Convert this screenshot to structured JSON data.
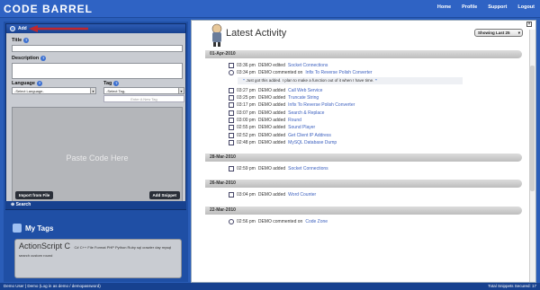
{
  "app": {
    "logo": "CODE BARREL"
  },
  "nav": {
    "items": [
      "Home",
      "Profile",
      "Support",
      "Logout"
    ]
  },
  "add_panel": {
    "header": "Add",
    "title_label": "Title",
    "description_label": "Description",
    "language_label": "Language",
    "language_value": "-Select Language-",
    "tag_label": "Tag",
    "tag_value": "-Select Tag-",
    "new_tag_placeholder": "Enter A New Tag",
    "paste_placeholder": "Paste Code Here",
    "import_button": "Import from File",
    "add_button": "Add Snippet",
    "search_label": "Search"
  },
  "tags": {
    "title": "My Tags",
    "cloud_big": "ActionScript C",
    "cloud_small": "C# C++ File Format PHP Python Ruby sql crawler day mysql search custom round"
  },
  "activity": {
    "title": "Latest Activity",
    "filter": "Showing Last 25",
    "groups": [
      {
        "date": "01-Apr-2010",
        "entries": [
          {
            "time": "03:36 pm",
            "text": "DEMO edited",
            "link": "Socket Connections"
          },
          {
            "time": "03:34 pm",
            "text": "DEMO commented on",
            "link": "Infix To Reverse Polish Converter",
            "comment": "Just got this added.  I plan to make a function out of it when I have time."
          },
          {
            "time": "03:27 pm",
            "text": "DEMO added",
            "link": "Call Web Service"
          },
          {
            "time": "03:25 pm",
            "text": "DEMO added",
            "link": "Truncate String"
          },
          {
            "time": "03:17 pm",
            "text": "DEMO added",
            "link": "Infix To Reverse Polish Converter"
          },
          {
            "time": "03:07 pm",
            "text": "DEMO added",
            "link": "Search & Replace"
          },
          {
            "time": "03:00 pm",
            "text": "DEMO added",
            "link": "Round"
          },
          {
            "time": "02:55 pm",
            "text": "DEMO added",
            "link": "Sound Player"
          },
          {
            "time": "02:52 pm",
            "text": "DEMO added",
            "link": "Get Client IP Address"
          },
          {
            "time": "02:48 pm",
            "text": "DEMO added",
            "link": "MySQL Database Dump"
          }
        ]
      },
      {
        "date": "28-Mar-2010",
        "entries": [
          {
            "time": "02:59 pm",
            "text": "DEMO added",
            "link": "Socket Connections"
          }
        ]
      },
      {
        "date": "26-Mar-2010",
        "entries": [
          {
            "time": "03:04 pm",
            "text": "DEMO added",
            "link": "Word Counter"
          }
        ]
      },
      {
        "date": "22-Mar-2010",
        "entries": [
          {
            "time": "02:56 pm",
            "text": "DEMO commented on",
            "link": "Code Zone"
          }
        ]
      }
    ]
  },
  "status": {
    "left": "Demo User  |  Demo (Log in as demo / demopassword)",
    "right": "Total Snippets Secured: 17"
  },
  "colors": {
    "accent": "#2f63c4",
    "link": "#3b5fbe",
    "arrow": "#c0272d"
  }
}
